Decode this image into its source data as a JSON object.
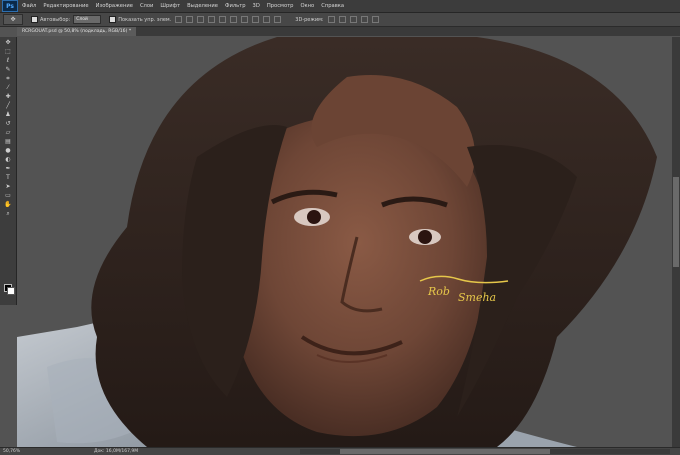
{
  "app": {
    "logo": "Ps"
  },
  "menu": [
    "Файл",
    "Редактирование",
    "Изображение",
    "Слои",
    "Шрифт",
    "Выделение",
    "Фильтр",
    "3D",
    "Просмотр",
    "Окно",
    "Справка"
  ],
  "options": {
    "tool_icon": "move-tool-icon",
    "autoselect_label": "Автовыбор:",
    "autoselect_value": "Слой",
    "show_controls_label": "Показать упр. элем.",
    "mode_3d_label": "3D-режим:"
  },
  "document": {
    "tab_title": "RCRGOUAT.psd @ 50,8% (подкладь, RGB/16) *"
  },
  "status": {
    "zoom": "50,76%",
    "doc_size": "Док: 16,0M/167,9M"
  },
  "canvas_signature": {
    "line1": "Rob",
    "line2": "Smeha"
  },
  "colors": {
    "app_bg": "#535353",
    "panel_bg": "#3d3d3d",
    "accent": "#d8b83a"
  }
}
